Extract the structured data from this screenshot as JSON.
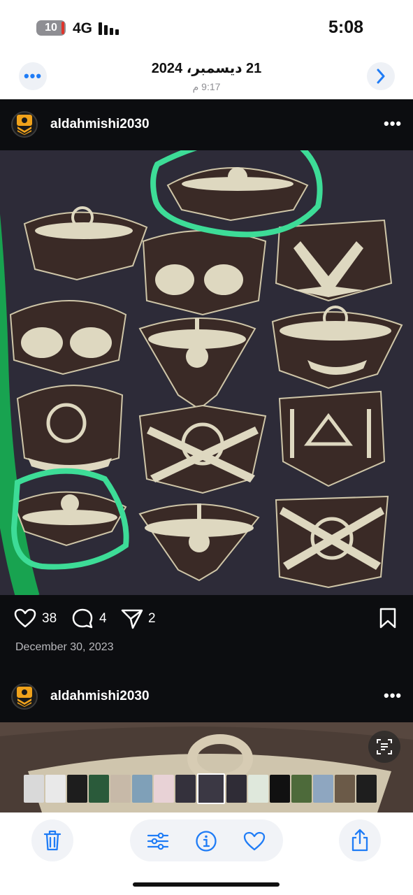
{
  "status_bar": {
    "battery": "10",
    "network": "4G",
    "time": "5:08"
  },
  "header": {
    "date": "21 ديسمبر، 2024",
    "time": "9:17 م",
    "more_icon": "ellipsis-icon",
    "next_icon": "chevron-right-icon"
  },
  "posts": [
    {
      "username": "aldahmishi2030",
      "likes": "38",
      "comments": "4",
      "shares": "2",
      "date": "December 30, 2023"
    },
    {
      "username": "aldahmishi2030"
    }
  ],
  "toolbar": {
    "delete_icon": "trash-icon",
    "adjust_icon": "sliders-icon",
    "info_icon": "info-icon",
    "favorite_icon": "heart-icon",
    "share_icon": "share-icon"
  },
  "colors": {
    "accent": "#1f7cf6",
    "highlight": "#3ddc97",
    "post_bg": "#0c0d10",
    "fabric": "#2d2b38",
    "patch": "#d9d4c0"
  }
}
